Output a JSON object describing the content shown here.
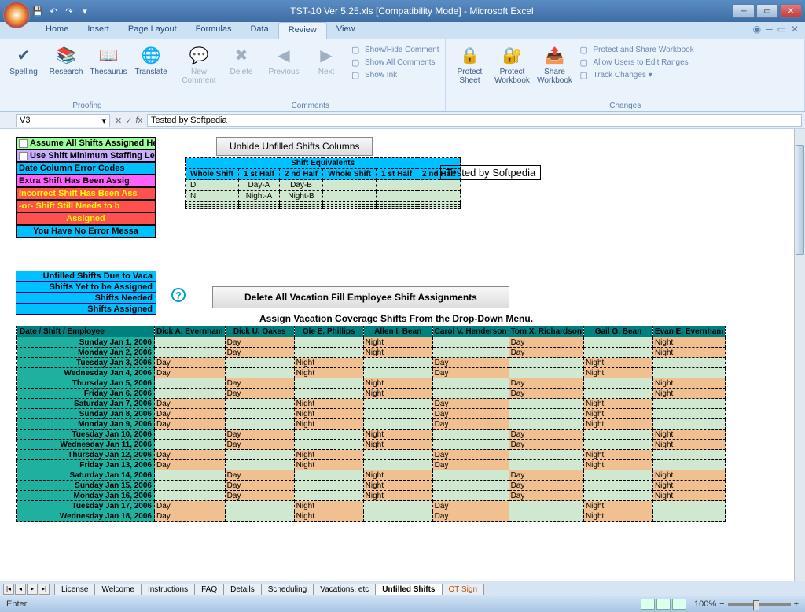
{
  "title": "TST-10 Ver 5.25.xls  [Compatibility Mode] - Microsoft Excel",
  "tabs": [
    "Home",
    "Insert",
    "Page Layout",
    "Formulas",
    "Data",
    "Review",
    "View"
  ],
  "activeTab": 5,
  "groups": {
    "proofing": {
      "label": "Proofing",
      "btns": [
        "Spelling",
        "Research",
        "Thesaurus",
        "Translate"
      ]
    },
    "comments": {
      "label": "Comments",
      "big": [
        "New Comment",
        "Delete",
        "Previous",
        "Next"
      ],
      "links": [
        "Show/Hide Comment",
        "Show All Comments",
        "Show Ink"
      ]
    },
    "changes": {
      "label": "Changes",
      "big": [
        "Protect Sheet",
        "Protect Workbook",
        "Share Workbook"
      ],
      "links": [
        "Protect and Share Workbook",
        "Allow Users to Edit Ranges",
        "Track Changes"
      ]
    }
  },
  "namebox": "V3",
  "formula": "Tested by Softpedia",
  "legend": [
    {
      "t": "Assume All Shifts Assigned Here a",
      "bg": "#9bff9b",
      "cb": true
    },
    {
      "t": "Use Shift Minimum Staffing Level",
      "bg": "#c8b0ff",
      "cb": true
    },
    {
      "t": "Date Column Error Codes",
      "bg": "#00c0ff"
    },
    {
      "t": "Extra Shift Has Been Assig",
      "bg": "#ff60ff"
    },
    {
      "t": "Incorrect Shift Has Been Ass",
      "bg": "#ff5050",
      "c": "#ffff00"
    },
    {
      "t": "-or- Shift Still Needs to b",
      "bg": "#ff5050",
      "c": "#ffff00"
    },
    {
      "t": "Assigned",
      "bg": "#ff5050",
      "c": "#ffff00",
      "ac": "center"
    },
    {
      "t": "You Have No Error Messa",
      "bg": "#00c0ff",
      "ac": "center"
    }
  ],
  "eqBtn": "Unhide Unfilled Shifts Columns",
  "eqTitle": "Shift Equivalents",
  "eqCols": [
    "Whole Shift",
    "1 st Half",
    "2 nd Half",
    "Whole Shift",
    "1 st Half",
    "2 nd Half"
  ],
  "eqRows": [
    [
      "D",
      "Day-A",
      "Day-B",
      "",
      "",
      ""
    ],
    [
      "N",
      "Night-A",
      "Night-B",
      "",
      "",
      ""
    ],
    [
      "",
      "",
      "",
      "",
      "",
      ""
    ],
    [
      "",
      "",
      "",
      "",
      "",
      ""
    ],
    [
      "",
      "",
      "",
      "",
      "",
      ""
    ]
  ],
  "tested": "Tested by Softpedia",
  "blues": [
    "Unfilled Shifts Due to Vaca",
    "Shifts Yet to be Assigned",
    "Shifts Needed",
    "Shifts Assigned"
  ],
  "delBtn": "Delete All Vacation Fill Employee Shift Assignments",
  "assignHdr": "Assign Vacation Coverage Shifts From the Drop-Down Menu.",
  "cols": [
    "Date / Shift / Employee",
    "Dick A. Evernham",
    "Dick U. Oakes",
    "Ole E. Phillips",
    "Allen I. Bean",
    "Carol V. Henderson",
    "Tom X. Richardson",
    "Gail G. Bean",
    "Evan E. Evernham"
  ],
  "rows": [
    {
      "d": "Sunday Jan 1, 2006",
      "c": [
        "",
        "Day",
        "",
        "Night",
        "",
        "Day",
        "",
        "Night"
      ]
    },
    {
      "d": "Monday Jan 2, 2006",
      "c": [
        "",
        "Day",
        "",
        "Night",
        "",
        "Day",
        "",
        "Night"
      ]
    },
    {
      "d": "Tuesday Jan 3, 2006",
      "c": [
        "Day",
        "",
        "Night",
        "",
        "Day",
        "",
        "Night",
        ""
      ]
    },
    {
      "d": "Wednesday Jan 4, 2006",
      "c": [
        "Day",
        "",
        "Night",
        "",
        "Day",
        "",
        "Night",
        ""
      ]
    },
    {
      "d": "Thursday Jan 5, 2006",
      "c": [
        "",
        "Day",
        "",
        "Night",
        "",
        "Day",
        "",
        "Night"
      ]
    },
    {
      "d": "Friday Jan 6, 2006",
      "c": [
        "",
        "Day",
        "",
        "Night",
        "",
        "Day",
        "",
        "Night"
      ]
    },
    {
      "d": "Saturday Jan 7, 2006",
      "c": [
        "Day",
        "",
        "Night",
        "",
        "Day",
        "",
        "Night",
        ""
      ]
    },
    {
      "d": "Sunday Jan 8, 2006",
      "c": [
        "Day",
        "",
        "Night",
        "",
        "Day",
        "",
        "Night",
        ""
      ]
    },
    {
      "d": "Monday Jan 9, 2006",
      "c": [
        "Day",
        "",
        "Night",
        "",
        "Day",
        "",
        "Night",
        ""
      ]
    },
    {
      "d": "Tuesday Jan 10, 2006",
      "c": [
        "",
        "Day",
        "",
        "Night",
        "",
        "Day",
        "",
        "Night"
      ]
    },
    {
      "d": "Wednesday Jan 11, 2006",
      "c": [
        "",
        "Day",
        "",
        "Night",
        "",
        "Day",
        "",
        "Night"
      ]
    },
    {
      "d": "Thursday Jan 12, 2006",
      "c": [
        "Day",
        "",
        "Night",
        "",
        "Day",
        "",
        "Night",
        ""
      ]
    },
    {
      "d": "Friday Jan 13, 2006",
      "c": [
        "Day",
        "",
        "Night",
        "",
        "Day",
        "",
        "Night",
        ""
      ]
    },
    {
      "d": "Saturday Jan 14, 2006",
      "c": [
        "",
        "Day",
        "",
        "Night",
        "",
        "Day",
        "",
        "Night"
      ]
    },
    {
      "d": "Sunday Jan 15, 2006",
      "c": [
        "",
        "Day",
        "",
        "Night",
        "",
        "Day",
        "",
        "Night"
      ]
    },
    {
      "d": "Monday Jan 16, 2006",
      "c": [
        "",
        "Day",
        "",
        "Night",
        "",
        "Day",
        "",
        "Night"
      ]
    },
    {
      "d": "Tuesday Jan 17, 2006",
      "c": [
        "Day",
        "",
        "Night",
        "",
        "Day",
        "",
        "Night",
        ""
      ]
    },
    {
      "d": "Wednesday Jan 18, 2006",
      "c": [
        "Day",
        "",
        "Night",
        "",
        "Day",
        "",
        "Night",
        ""
      ]
    }
  ],
  "sheetTabs": [
    {
      "t": "License"
    },
    {
      "t": "Welcome"
    },
    {
      "t": "Instructions"
    },
    {
      "t": "FAQ"
    },
    {
      "t": "Details"
    },
    {
      "t": "Scheduling"
    },
    {
      "t": "Vacations, etc"
    },
    {
      "t": "Unfilled Shifts",
      "active": true
    },
    {
      "t": "OT Sign",
      "orange": true
    }
  ],
  "status": "Enter",
  "zoom": "100%"
}
